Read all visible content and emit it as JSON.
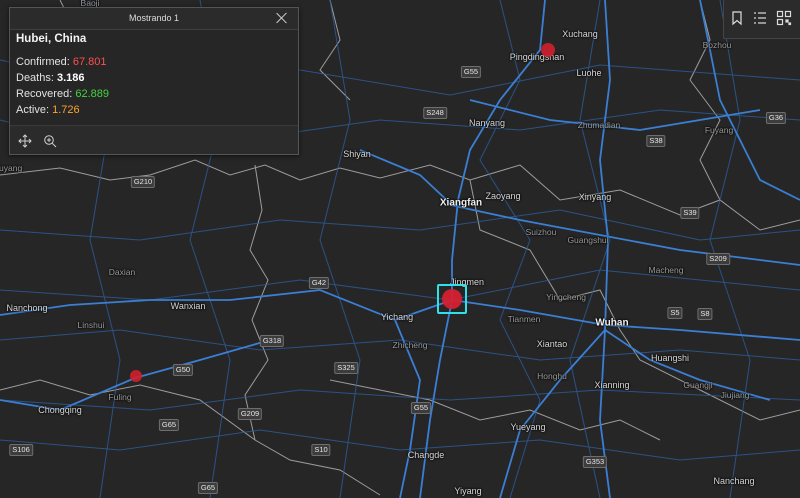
{
  "popup": {
    "header": "Mostrando 1",
    "title": "Hubei, China",
    "stats": [
      {
        "label": "Confirmed:",
        "value": "67.801",
        "color": "#ff4f4f"
      },
      {
        "label": "Deaths:",
        "value": "3.186",
        "color": "#ffffff"
      },
      {
        "label": "Recovered:",
        "value": "62.889",
        "color": "#45d33f"
      },
      {
        "label": "Active:",
        "value": "1.726",
        "color": "#ffa32e"
      }
    ],
    "actions": [
      "pan-icon",
      "zoom-to-icon"
    ]
  },
  "toolbar": [
    "bookmark-icon",
    "layer-list-icon",
    "qr-code-icon"
  ],
  "cities": [
    {
      "name": "Baoji",
      "cls": "minor"
    },
    {
      "name": "Xuchang",
      "cls": ""
    },
    {
      "name": "Pingdingshan",
      "cls": ""
    },
    {
      "name": "Bozhou",
      "cls": "minor"
    },
    {
      "name": "Luohe",
      "cls": ""
    },
    {
      "name": "Nanyang",
      "cls": ""
    },
    {
      "name": "Zhumadian",
      "cls": "minor"
    },
    {
      "name": "Fuyang",
      "cls": "minor"
    },
    {
      "name": "Shiyan",
      "cls": ""
    },
    {
      "name": "Xiangfan",
      "cls": "major"
    },
    {
      "name": "Zaoyang",
      "cls": ""
    },
    {
      "name": "Xinyang",
      "cls": ""
    },
    {
      "name": "Suizhou",
      "cls": "minor"
    },
    {
      "name": "Guangshui",
      "cls": "minor"
    },
    {
      "name": "Jingmen",
      "cls": ""
    },
    {
      "name": "Daxian",
      "cls": "minor"
    },
    {
      "name": "Wanxian",
      "cls": ""
    },
    {
      "name": "Nanchong",
      "cls": ""
    },
    {
      "name": "Linshui",
      "cls": "minor"
    },
    {
      "name": "Yichang",
      "cls": ""
    },
    {
      "name": "Yingcheng",
      "cls": "minor"
    },
    {
      "name": "Tianmen",
      "cls": "minor"
    },
    {
      "name": "Wuhan",
      "cls": "major"
    },
    {
      "name": "Macheng",
      "cls": "minor"
    },
    {
      "name": "Zhicheng",
      "cls": "minor"
    },
    {
      "name": "Xiantao",
      "cls": ""
    },
    {
      "name": "Huangshi",
      "cls": ""
    },
    {
      "name": "Honghu",
      "cls": "minor"
    },
    {
      "name": "Xianning",
      "cls": ""
    },
    {
      "name": "Guangji",
      "cls": "minor"
    },
    {
      "name": "Fuling",
      "cls": "minor"
    },
    {
      "name": "Chongqing",
      "cls": ""
    },
    {
      "name": "Yueyang",
      "cls": ""
    },
    {
      "name": "Jiujiang",
      "cls": "minor"
    },
    {
      "name": "Changde",
      "cls": ""
    },
    {
      "name": "Nanchang",
      "cls": ""
    },
    {
      "name": "Yiyang",
      "cls": ""
    },
    {
      "name": "Yuyang",
      "cls": "minor"
    }
  ],
  "shields": [
    "G210",
    "G55",
    "S248",
    "G36",
    "S38",
    "S39",
    "S209",
    "S8",
    "G42",
    "G318",
    "G50",
    "S325",
    "S5",
    "G65",
    "S106",
    "G55",
    "S10",
    "G353",
    "G65",
    "G209"
  ],
  "markers": [
    {
      "name": "hubei-marker",
      "color": "#d42030",
      "selected": true
    },
    {
      "name": "henan-marker",
      "color": "#c8202c",
      "selected": false
    },
    {
      "name": "chongqing-marker",
      "color": "#c8202c",
      "selected": false
    }
  ]
}
